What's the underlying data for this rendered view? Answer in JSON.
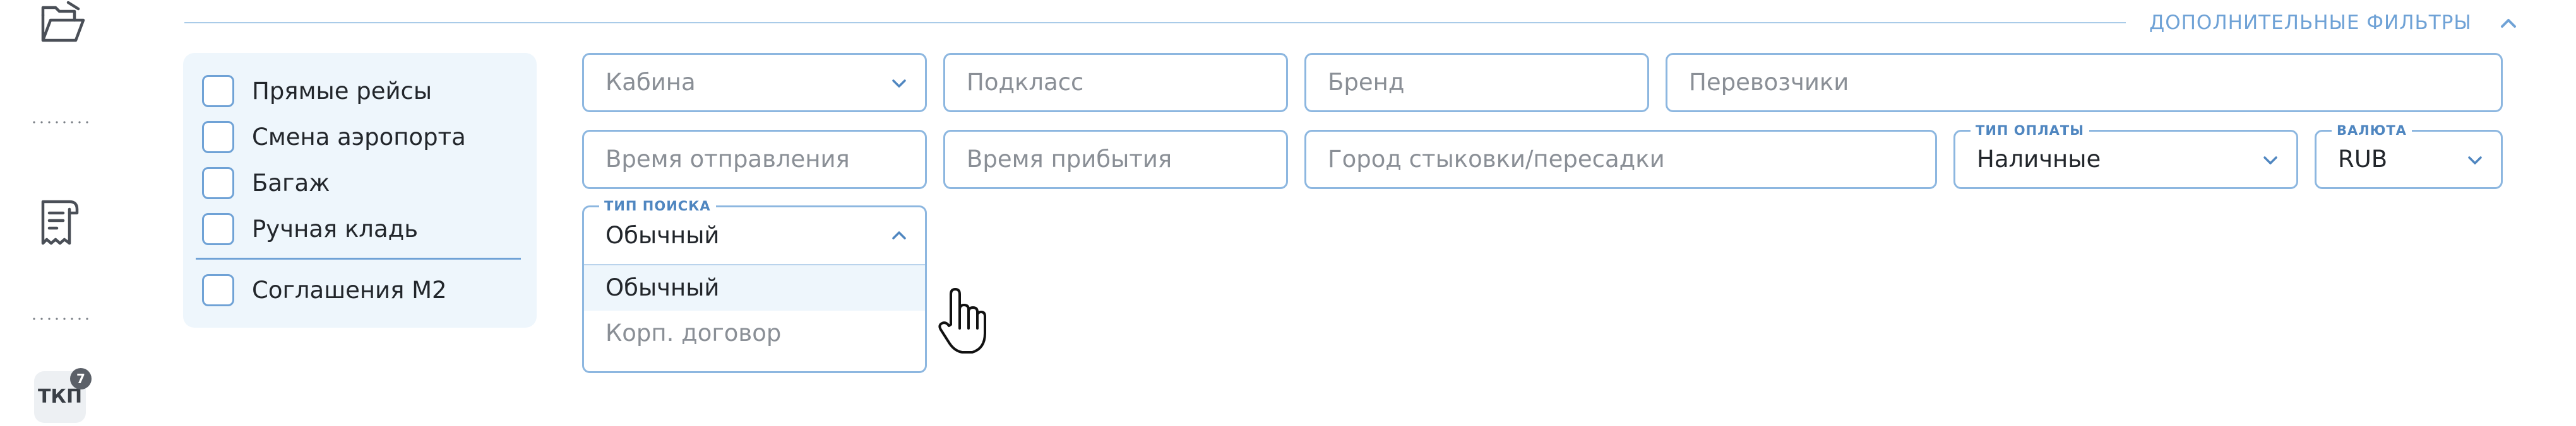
{
  "sidebar": {
    "icons": [
      "folder-open-icon",
      "receipt-icon"
    ],
    "tkp_label": "ТКП",
    "tkp_badge": "7"
  },
  "filters_header": {
    "title": "ДОПОЛНИТЕЛЬНЫЕ ФИЛЬТРЫ"
  },
  "checkboxes": [
    {
      "label": "Прямые рейсы",
      "checked": false
    },
    {
      "label": "Смена аэропорта",
      "checked": false
    },
    {
      "label": "Багаж",
      "checked": false
    },
    {
      "label": "Ручная кладь",
      "checked": false
    },
    {
      "label": "Соглашения М2",
      "checked": false
    }
  ],
  "fields": {
    "cabin": {
      "placeholder": "Кабина"
    },
    "subclass": {
      "placeholder": "Подкласс"
    },
    "brand": {
      "placeholder": "Бренд"
    },
    "carriers": {
      "placeholder": "Перевозчики"
    },
    "departure_time": {
      "placeholder": "Время отправления"
    },
    "arrival_time": {
      "placeholder": "Время прибытия"
    },
    "transfer_city": {
      "placeholder": "Город стыковки/пересадки"
    },
    "payment_type": {
      "legend": "ТИП ОПЛАТЫ",
      "value": "Наличные"
    },
    "currency": {
      "legend": "ВАЛЮТА",
      "value": "RUB"
    },
    "search_type": {
      "legend": "ТИП ПОИСКА",
      "value": "Обычный",
      "options": [
        "Обычный",
        "Корп. договор"
      ]
    }
  },
  "colors": {
    "accent": "#6fa2d6",
    "field_border": "#8db7e0",
    "panel_bg": "#eef6fc"
  }
}
